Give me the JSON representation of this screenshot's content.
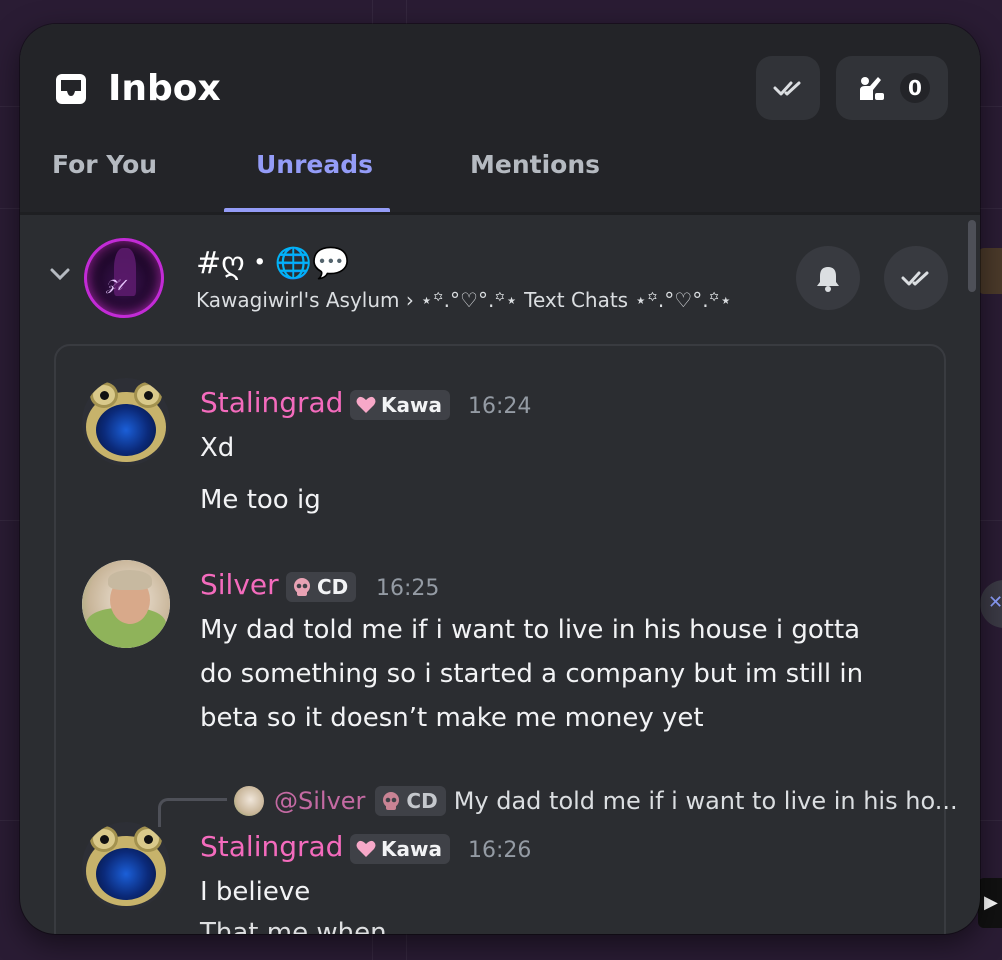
{
  "header": {
    "title": "Inbox",
    "mark_all_read_icon": "double-check-icon",
    "requests_icon": "person-wave-icon",
    "requests_count": "0"
  },
  "tabs": [
    {
      "label": "For You",
      "active": false
    },
    {
      "label": "Unreads",
      "active": true
    },
    {
      "label": "Mentions",
      "active": false
    }
  ],
  "channel": {
    "name": "#ღ・🌐💬",
    "path": "Kawagiwirl's Asylum › ⋆꙳.°♡°.꙳⋆ Text Chats ⋆꙳.°♡°.꙳⋆",
    "bell_icon": "bell-icon",
    "mark_read_icon": "double-check-icon"
  },
  "messages": [
    {
      "author": "Stalingrad",
      "tag": "Kawa",
      "tag_icon": "heart-icon",
      "time": "16:24",
      "lines": [
        "Xd",
        "Me too ig"
      ]
    },
    {
      "author": "Silver",
      "tag": "CD",
      "tag_icon": "skull-icon",
      "time": "16:25",
      "lines": [
        "My dad told me if i want to live in his house i gotta",
        "do something so i started a company but im still in",
        "beta so it doesn’t make me money yet"
      ]
    },
    {
      "reply": {
        "name": "@Silver",
        "tag": "CD",
        "text": "My dad told me if i want to live in his ho..."
      },
      "author": "Stalingrad",
      "tag": "Kawa",
      "tag_icon": "heart-icon",
      "time": "16:26",
      "lines": [
        "I believe"
      ],
      "cut_line": "That me when........"
    }
  ],
  "colors": {
    "accent": "#949cf7",
    "author": "#f46bbd",
    "panel": "#2b2d31",
    "header": "#232428"
  }
}
